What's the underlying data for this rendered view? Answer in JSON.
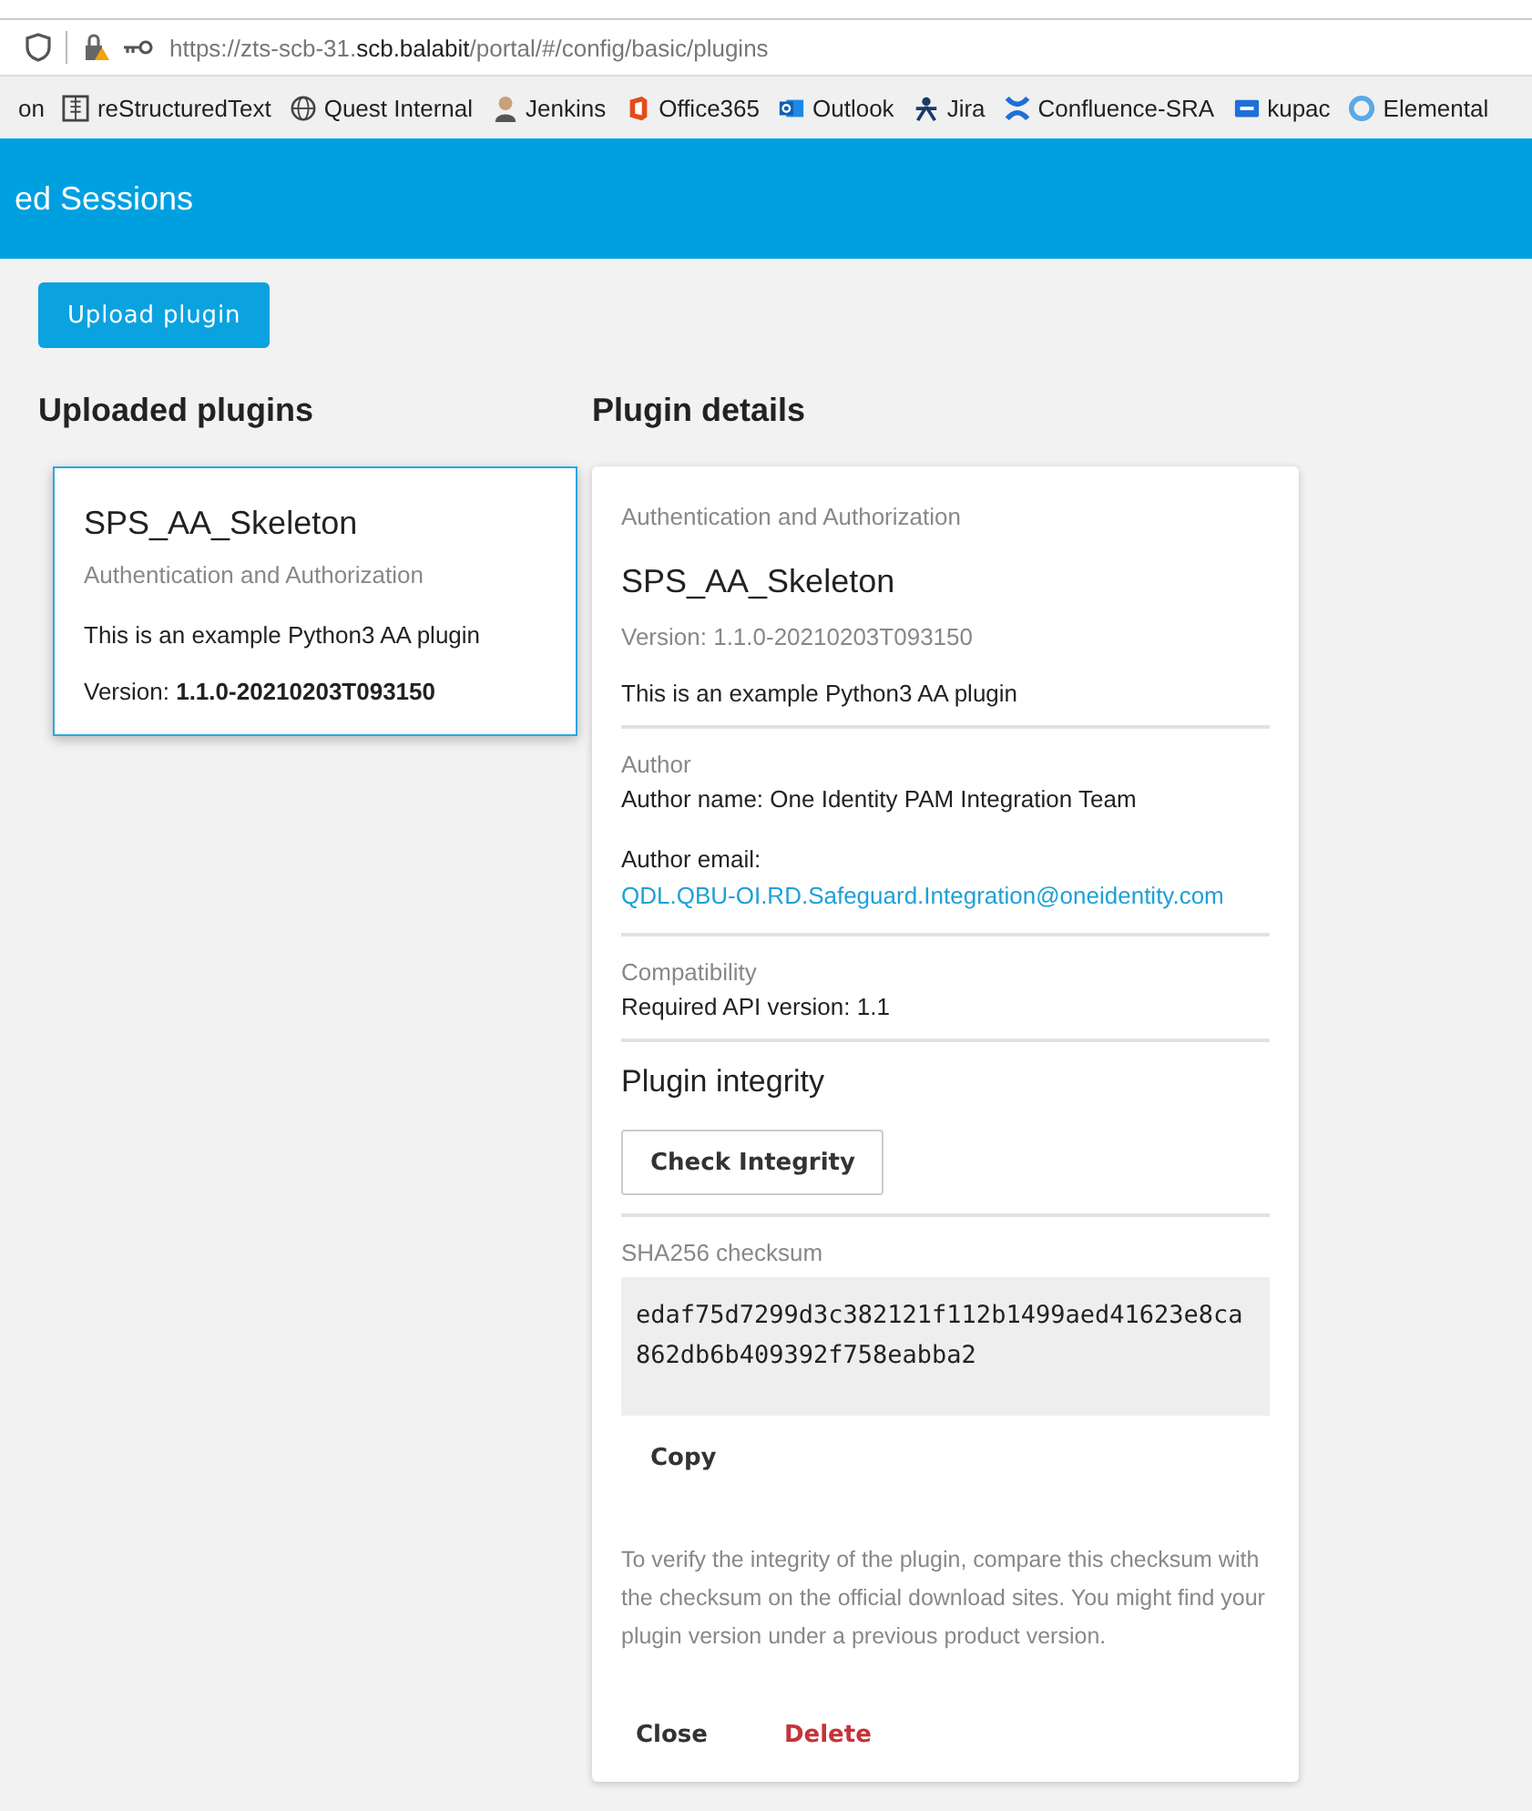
{
  "browser": {
    "url": "https://zts-scb-31.**scb.balabit**/portal/#/config/basic/plugins",
    "bookmarks": [
      {
        "label": "on",
        "kind": "none"
      },
      {
        "label": "reStructuredText",
        "kind": "doc"
      },
      {
        "label": "Quest Internal",
        "kind": "globe"
      },
      {
        "label": "Jenkins",
        "kind": "person"
      },
      {
        "label": "Office365",
        "kind": "office"
      },
      {
        "label": "Outlook",
        "kind": "mail"
      },
      {
        "label": "Jira",
        "kind": "tool"
      },
      {
        "label": "Confluence-SRA",
        "kind": "cross"
      },
      {
        "label": "kupac",
        "kind": "badge"
      },
      {
        "label": "Elemental",
        "kind": "ring"
      }
    ]
  },
  "header": {
    "title": "ed Sessions"
  },
  "upload_button": "Upload plugin",
  "uploaded": {
    "heading": "Uploaded plugins",
    "plugins": [
      {
        "name": "SPS_AA_Skeleton",
        "category": "Authentication and Authorization",
        "description": "This is an example Python3 AA plugin",
        "version": "Version: **1.1.0-20210203T093150**",
        "selected": true
      }
    ]
  },
  "details": {
    "heading": "Plugin details",
    "category": "Authentication and Authorization",
    "name": "SPS_AA_Skeleton",
    "version": "Version: 1.1.0-20210203T093150",
    "description": "This is an example Python3 AA plugin",
    "author_label": "Author",
    "author_name": "Author name: One Identity PAM Integration Team",
    "author_email_label": "Author email:",
    "author_email": "QDL.QBU-OI.RD.Safeguard.Integration@oneidentity.com",
    "compat_label": "Compatibility",
    "api_version": "Required API version: 1.1",
    "integrity_heading": "Plugin integrity",
    "check_button": "Check Integrity",
    "checksum_label": "SHA256 checksum",
    "checksum": "edaf75d7299d3c382121f112b1499aed41623e8ca862db6b409392f758eabba2",
    "copy_button": "Copy",
    "note": "To verify the integrity of the plugin, compare this checksum with the checksum on the official download sites. You might find your plugin version under a previous product version.",
    "actions": [
      {
        "label": "Close",
        "kind": "neutral"
      },
      {
        "label": "Delete",
        "kind": "danger"
      }
    ]
  }
}
